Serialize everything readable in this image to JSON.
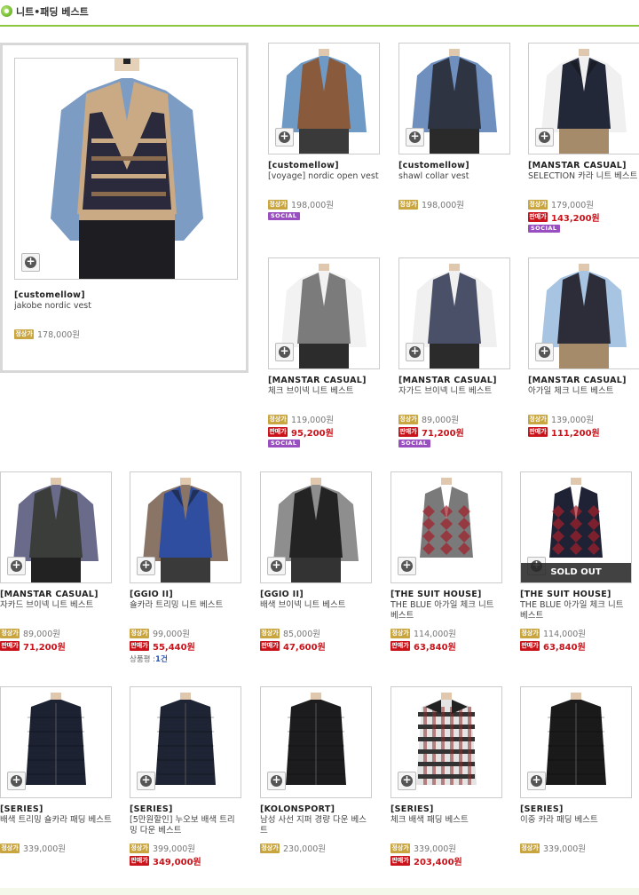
{
  "header": {
    "title": "니트•패딩 베스트"
  },
  "labels": {
    "regular": "정상가",
    "sale": "판매가",
    "social": "SOCIAL",
    "sold_out": "SOLD OUT",
    "review_prefix": "상품평 :"
  },
  "featured": {
    "brand": "[customellow]",
    "name": "jakobe nordic vest",
    "regular_price": "178,000원",
    "icon": "zoom-plus-icon"
  },
  "products": [
    {
      "brand": "[customellow]",
      "name": "[voyage] nordic open vest",
      "regular_price": "198,000원",
      "sale_price": "",
      "social": true
    },
    {
      "brand": "[customellow]",
      "name": "shawl collar vest",
      "regular_price": "198,000원",
      "sale_price": "",
      "social": false
    },
    {
      "brand": "[MANSTAR CASUAL]",
      "name": "SELECTION 카라 니트 베스트",
      "regular_price": "179,000원",
      "sale_price": "143,200원",
      "social": true
    },
    {
      "brand": "[MANSTAR CASUAL]",
      "name": "체크 브이넥 니트 베스트",
      "regular_price": "119,000원",
      "sale_price": "95,200원",
      "social": true
    },
    {
      "brand": "[MANSTAR CASUAL]",
      "name": "자가드 브이넥 니트 베스트",
      "regular_price": "89,000원",
      "sale_price": "71,200원",
      "social": true
    },
    {
      "brand": "[MANSTAR CASUAL]",
      "name": "아가일 체크 니트 베스트",
      "regular_price": "139,000원",
      "sale_price": "111,200원",
      "social": false
    },
    {
      "brand": "[MANSTAR CASUAL]",
      "name": "자카드 브이넥 니트 베스트",
      "regular_price": "89,000원",
      "sale_price": "71,200원",
      "social": false
    },
    {
      "brand": "[GGIO II]",
      "name": "숄카라 트리밍 니트 베스트",
      "regular_price": "99,000원",
      "sale_price": "55,440원",
      "social": false,
      "review_count": "1건"
    },
    {
      "brand": "[GGIO II]",
      "name": "배색 브이넥 니트 베스트",
      "regular_price": "85,000원",
      "sale_price": "47,600원",
      "social": false
    },
    {
      "brand": "[THE SUIT HOUSE]",
      "name": "THE BLUE 아가일 체크 니트 베스트",
      "regular_price": "114,000원",
      "sale_price": "63,840원",
      "social": false
    },
    {
      "brand": "[THE SUIT HOUSE]",
      "name": "THE BLUE 아가일 체크 니트 베스트",
      "regular_price": "114,000원",
      "sale_price": "63,840원",
      "social": false,
      "sold_out": true
    },
    {
      "brand": "[SERIES]",
      "name": "배색 트리밍 숄카라 패딩 베스트",
      "regular_price": "339,000원",
      "sale_price": "",
      "social": false
    },
    {
      "brand": "[SERIES]",
      "name": "[5만원할인] 누오보 배색 트리밍 다운 베스트",
      "regular_price": "399,000원",
      "sale_price": "349,000원",
      "social": false
    },
    {
      "brand": "[KOLONSPORT]",
      "name": "남성 사선 지퍼 경량 다운 베스트",
      "regular_price": "230,000원",
      "sale_price": "",
      "social": false
    },
    {
      "brand": "[SERIES]",
      "name": "체크 배색 패딩 베스트",
      "regular_price": "339,000원",
      "sale_price": "203,400원",
      "social": false
    },
    {
      "brand": "[SERIES]",
      "name": "이중 카라 패딩 베스트",
      "regular_price": "339,000원",
      "sale_price": "",
      "social": false
    }
  ],
  "colors": {
    "accent_green": "#8cc63f",
    "regular_badge": "#c8a53e",
    "sale_red": "#c9141b",
    "social_purple": "#9a4fc0"
  }
}
